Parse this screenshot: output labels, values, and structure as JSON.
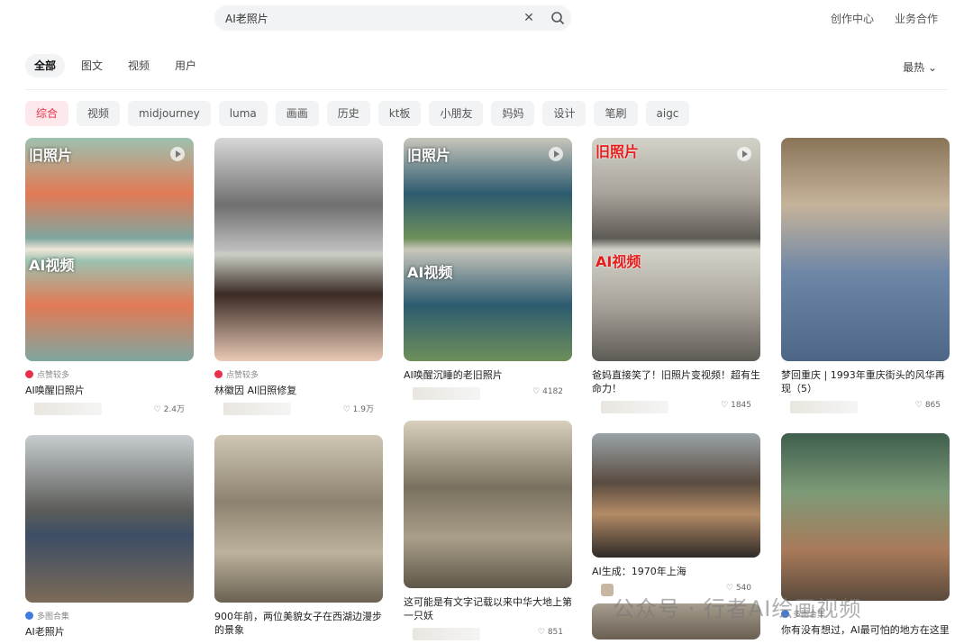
{
  "search": {
    "value": "AI老照片"
  },
  "top_links": [
    "创作中心",
    "业务合作"
  ],
  "tabs": [
    "全部",
    "图文",
    "视频",
    "用户"
  ],
  "sort": "最热",
  "chips": [
    "综合",
    "视频",
    "midjourney",
    "luma",
    "画画",
    "历史",
    "kt板",
    "小朋友",
    "妈妈",
    "设计",
    "笔刷",
    "aigc"
  ],
  "colors": {
    "accent": "#e8304b"
  },
  "cards": [
    {
      "label_top": "旧照片",
      "label_mid": "AI视频",
      "badge": "点赞较多",
      "title": "AI唤醒旧照片",
      "likes": "2.4万"
    },
    {
      "badge": "点赞较多",
      "title": "林徽因 AI旧照修复",
      "likes": "1.9万"
    },
    {
      "label_top": "旧照片",
      "label_mid": "AI视频",
      "title": "AI唤醒沉睡的老旧照片",
      "likes": "4182"
    },
    {
      "label_top": "旧照片",
      "label_mid": "AI视频",
      "title": "爸妈直接笑了！旧照片变视频！超有生命力！",
      "likes": "1845"
    },
    {
      "title": "梦回重庆 | 1993年重庆街头的风华再现（5）",
      "likes": "865"
    },
    {
      "badge": "多图合集",
      "title": "AI老照片"
    },
    {
      "title": "900年前，两位美貌女子在西湖边漫步的景象"
    },
    {
      "title": "这可能是有文字记载以来中华大地上第一只妖",
      "likes": "851"
    },
    {
      "title": "AI生成：1970年上海",
      "likes": "540"
    },
    {
      "badge": "多图合集",
      "title": "你有没有想过，AI最可怕的地方在这里"
    }
  ],
  "watermark": "公众号 · 行者AI绘画视频"
}
